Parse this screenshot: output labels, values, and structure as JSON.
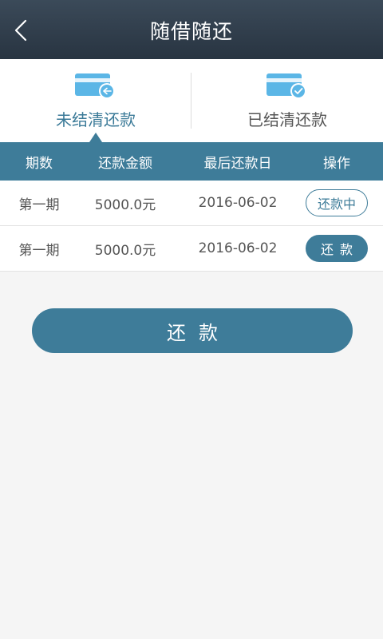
{
  "header": {
    "title": "随借随还"
  },
  "tabs": [
    {
      "label": "未结清还款",
      "icon": "card-return-icon",
      "active": true
    },
    {
      "label": "已结清还款",
      "icon": "card-check-icon",
      "active": false
    }
  ],
  "colors": {
    "accent": "#3e7c99",
    "header_bg": "#2e3b48",
    "card_icon": "#5bb6e6"
  },
  "table": {
    "columns": [
      "期数",
      "还款金额",
      "最后还款日",
      "操作"
    ],
    "rows": [
      {
        "period": "第一期",
        "amount": "5000.0元",
        "due_date": "2016-06-02",
        "action": "还款中"
      },
      {
        "period": "第一期",
        "amount": "5000.0元",
        "due_date": "2016-06-02",
        "action": "还款"
      }
    ]
  },
  "repay_button": {
    "label": "还款"
  }
}
